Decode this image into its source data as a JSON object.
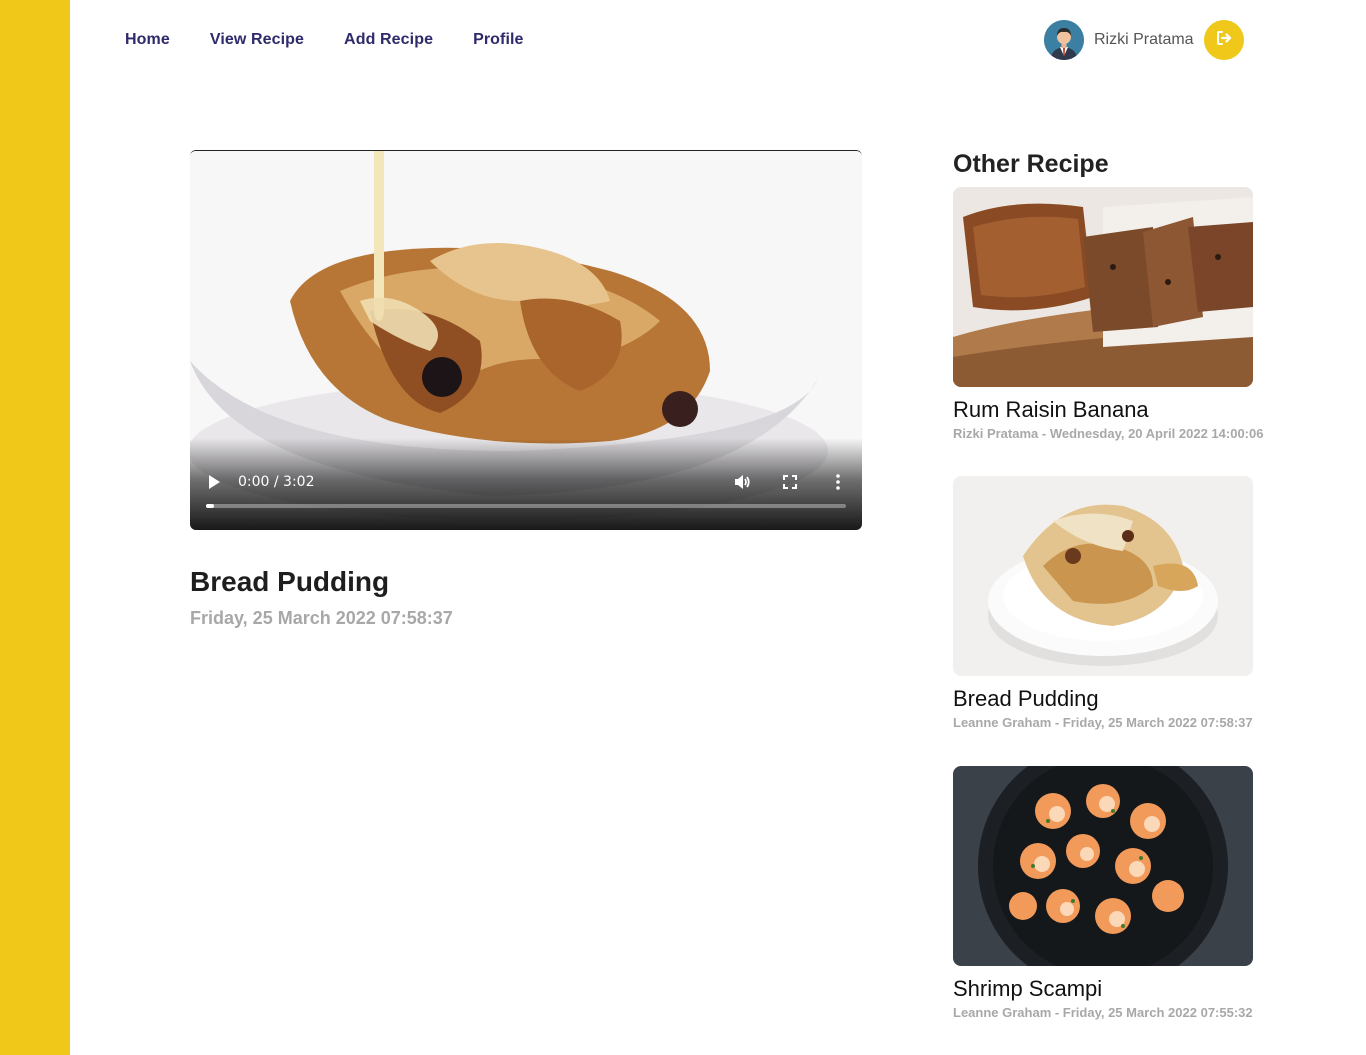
{
  "nav": {
    "items": [
      {
        "label": "Home"
      },
      {
        "label": "View Recipe"
      },
      {
        "label": "Add Recipe"
      },
      {
        "label": "Profile"
      }
    ]
  },
  "user": {
    "name": "Rizki Pratama",
    "avatar_icon": "user-avatar-icon",
    "logout_icon": "sign-out-icon"
  },
  "video": {
    "time": "0:00 / 3:02",
    "progress": 0.0,
    "play_icon": "play-icon",
    "volume_icon": "volume-icon",
    "fullscreen_icon": "fullscreen-icon",
    "more_icon": "more-vertical-icon"
  },
  "recipe": {
    "title": "Bread Pudding",
    "date": "Friday, 25 March 2022 07:58:37"
  },
  "other": {
    "heading": "Other Recipe",
    "items": [
      {
        "title": "Rum Raisin Banana",
        "meta": "Rizki Pratama - Wednesday, 20 April 2022 14:00:06"
      },
      {
        "title": "Bread Pudding",
        "meta": "Leanne Graham - Friday, 25 March 2022 07:58:37"
      },
      {
        "title": "Shrimp Scampi",
        "meta": "Leanne Graham - Friday, 25 March 2022 07:55:32"
      }
    ]
  },
  "colors": {
    "accent": "#efc81a",
    "nav_text": "#2e2a6b",
    "muted_text": "#a8a8a8"
  }
}
